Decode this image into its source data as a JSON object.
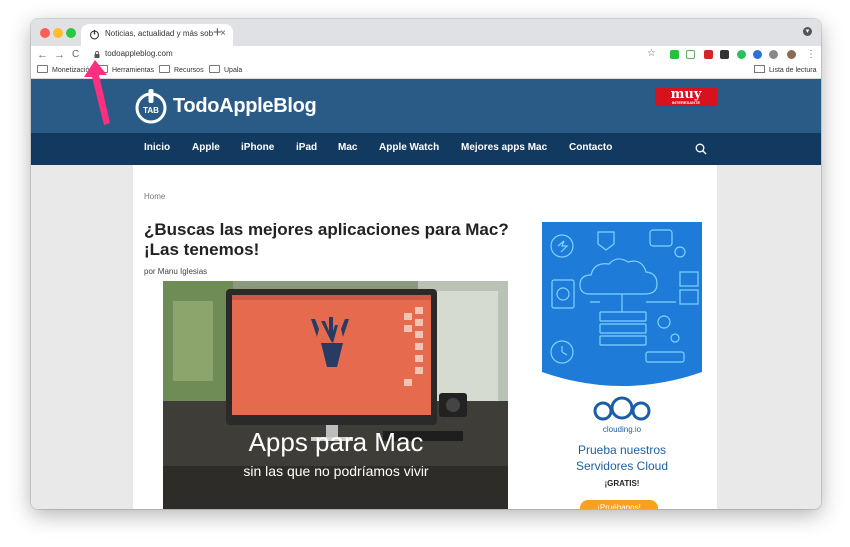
{
  "browser": {
    "tab_title": "Noticias, actualidad y más sob",
    "tab_close": "×",
    "new_tab": "+",
    "back": "←",
    "forward": "→",
    "reload": "C",
    "url": "todoappleblog.com",
    "star": "☆",
    "bookmarks": [
      {
        "label": "Monetización"
      },
      {
        "label": "Herramientas"
      },
      {
        "label": "Recursos"
      },
      {
        "label": "Upala"
      }
    ],
    "reading_list": "Lista de lectura"
  },
  "site": {
    "logo_badge": "TAB",
    "logo_name": "TodoAppleBlog",
    "partner_logo": "muy",
    "partner_logo_sub": "INTERESANTE",
    "nav": [
      {
        "label": "Inicio"
      },
      {
        "label": "Apple"
      },
      {
        "label": "iPhone"
      },
      {
        "label": "iPad"
      },
      {
        "label": "Mac"
      },
      {
        "label": "Apple Watch"
      },
      {
        "label": "Mejores apps Mac"
      },
      {
        "label": "Contacto"
      }
    ]
  },
  "article": {
    "breadcrumb": "Home",
    "title": "¿Buscas las mejores aplicaciones para Mac? ¡Las tenemos!",
    "byline": "por Manu Iglesias",
    "hero_title": "Apps para Mac",
    "hero_subtitle": "sin las que no podríamos vivir"
  },
  "ad": {
    "brand": "clouding.io",
    "line1": "Prueba nuestros",
    "line2": "Servidores Cloud",
    "gratis": "¡GRATIS!",
    "cta": "¡Pruébanos!"
  },
  "colors": {
    "header_blue": "#2a5b87",
    "nav_dark_blue": "#123a60",
    "ad_blue": "#1f7bd8",
    "cta_orange": "#f7a21c",
    "arrow_pink": "#ff2e7e"
  }
}
